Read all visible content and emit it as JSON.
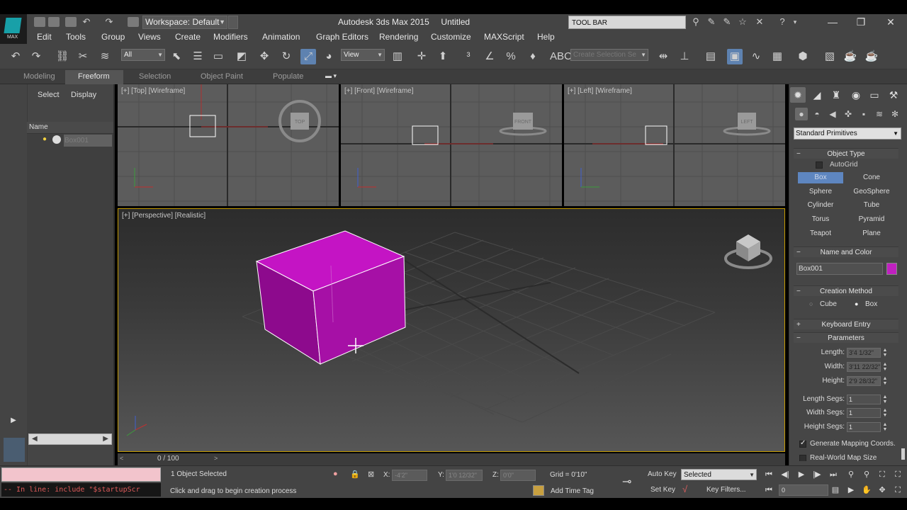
{
  "app": {
    "title": "Autodesk 3ds Max  2015",
    "document": "Untitled",
    "logo_text": "MAX",
    "workspace": "Workspace: Default",
    "search_placeholder": "TOOL BAR"
  },
  "menu": [
    "Edit",
    "Tools",
    "Group",
    "Views",
    "Create",
    "Modifiers",
    "Animation",
    "Graph Editors",
    "Rendering",
    "Customize",
    "MAXScript",
    "Help"
  ],
  "toolbar": {
    "selection_filter": "All",
    "reference_coord": "View",
    "named_selection_placeholder": "Create Selection Se",
    "icons": [
      "undo-icon",
      "redo-icon",
      "link-icon",
      "unlink-icon",
      "bind-space-warp-icon",
      "select-object-icon",
      "select-by-name-icon",
      "rect-selection-icon",
      "window-crossing-icon",
      "move-icon",
      "rotate-icon",
      "scale-icon",
      "place-icon",
      "pivot-icon",
      "manipulate-icon",
      "keyboard-shortcut-icon",
      "snaps-icon",
      "angle-snap-icon",
      "percent-snap-icon",
      "spinner-snap-icon",
      "edit-named-selections-icon",
      "mirror-icon",
      "align-icon",
      "layer-explorer-icon",
      "scene-explorer-icon",
      "curve-editor-icon",
      "schematic-view-icon",
      "material-editor-icon",
      "render-setup-icon",
      "rendered-frame-icon",
      "render-icon"
    ]
  },
  "ribbon": {
    "tabs": [
      "Modeling",
      "Freeform",
      "Selection",
      "Object Paint",
      "Populate"
    ],
    "active": "Freeform"
  },
  "scene_explorer": {
    "tabs": [
      "Select",
      "Display"
    ],
    "column_header": "Name",
    "objects": [
      "Box001"
    ]
  },
  "viewports": {
    "top": "[+] [Top] [Wireframe]",
    "front": "[+] [Front] [Wireframe]",
    "left": "[+] [Left] [Wireframe]",
    "perspective": "[+] [Perspective] [Realistic]",
    "viewcube_labels": {
      "top": "TOP",
      "front": "FRONT",
      "left": "LEFT"
    },
    "box_color": "#c020c0"
  },
  "command_panel": {
    "category": "Standard Primitives",
    "object_type": {
      "title": "Object Type",
      "autogrid_label": "AutoGrid",
      "autogrid_checked": false,
      "buttons": [
        "Box",
        "Cone",
        "Sphere",
        "GeoSphere",
        "Cylinder",
        "Tube",
        "Torus",
        "Pyramid",
        "Teapot",
        "Plane"
      ],
      "active": "Box"
    },
    "name_and_color": {
      "title": "Name and Color",
      "name": "Box001",
      "color": "#c020c0"
    },
    "creation_method": {
      "title": "Creation Method",
      "options": [
        "Cube",
        "Box"
      ],
      "selected": "Box"
    },
    "keyboard_entry": {
      "title": "Keyboard Entry"
    },
    "parameters": {
      "title": "Parameters",
      "length_label": "Length:",
      "length": "3'4 1/32\"",
      "width_label": "Width:",
      "width": "3'11 22/32\"",
      "height_label": "Height:",
      "height": "2'9 28/32\"",
      "length_segs_label": "Length Segs:",
      "length_segs": "1",
      "width_segs_label": "Width Segs:",
      "width_segs": "1",
      "height_segs_label": "Height Segs:",
      "height_segs": "1",
      "generate_mapping_label": "Generate Mapping Coords.",
      "generate_mapping_checked": true,
      "real_world_label": "Real-World Map Size"
    }
  },
  "timeline": {
    "frame": "0 / 100"
  },
  "status": {
    "maxscript_output": "-- In line: include \"$startupScr",
    "selection": "1 Object Selected",
    "prompt": "Click and drag to begin creation process",
    "x_label": "X:",
    "x_value": "-4'2\"",
    "y_label": "Y:",
    "y_value": "1'0 12/32\"",
    "z_label": "Z:",
    "z_value": "0'0\"",
    "grid": "Grid = 0'10\"",
    "add_time_tag": "Add Time Tag",
    "auto_key": "Auto Key",
    "set_key": "Set Key",
    "key_mode": "Selected",
    "key_filters": "Key Filters...",
    "current_frame": "0"
  }
}
